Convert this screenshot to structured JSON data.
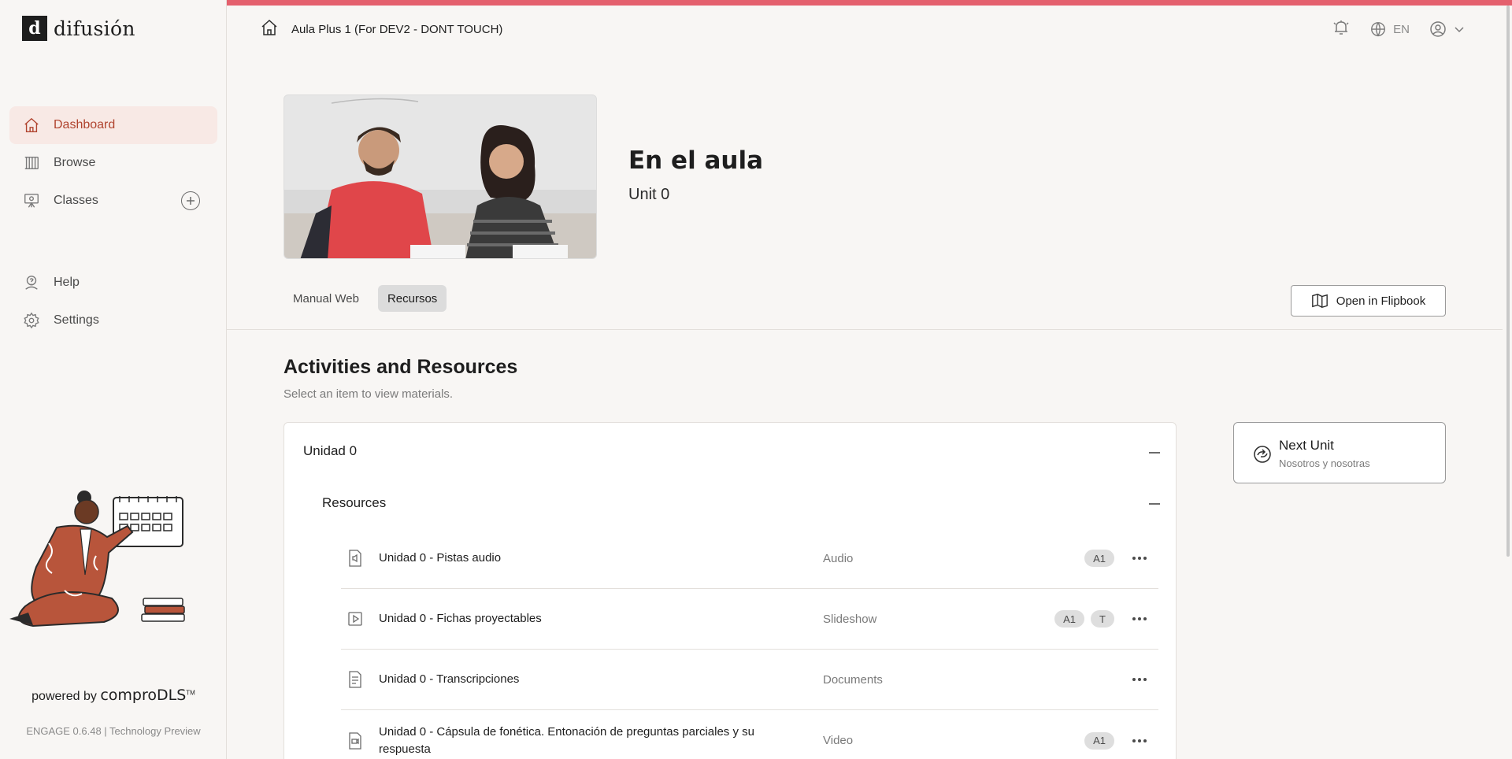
{
  "brand": {
    "logo_letter": "d",
    "name": "difusión"
  },
  "sidebar": {
    "items": [
      {
        "label": "Dashboard",
        "icon": "home-icon",
        "active": true
      },
      {
        "label": "Browse",
        "icon": "library-icon"
      },
      {
        "label": "Classes",
        "icon": "classroom-icon"
      },
      {
        "label": "Help",
        "icon": "help-icon"
      },
      {
        "label": "Settings",
        "icon": "gear-icon"
      }
    ],
    "powered_by": "powered by",
    "powered_brand": "comproDLS",
    "powered_tm": "TM",
    "version": "ENGAGE 0.6.48 | Technology Preview"
  },
  "header": {
    "breadcrumb": "Aula Plus 1 (For DEV2 - DONT TOUCH)",
    "language": "EN"
  },
  "hero": {
    "title": "En el aula",
    "subtitle": "Unit 0"
  },
  "tabs": [
    {
      "label": "Manual Web",
      "active": false
    },
    {
      "label": "Recursos",
      "active": true
    }
  ],
  "flipbook_button": "Open in Flipbook",
  "section": {
    "title": "Activities and Resources",
    "subtitle": "Select an item to view materials."
  },
  "unit": {
    "title": "Unidad 0",
    "group_title": "Resources",
    "resources": [
      {
        "title": "Unidad 0 - Pistas audio",
        "type": "Audio",
        "icon": "audio-file-icon",
        "badges": [
          "A1"
        ]
      },
      {
        "title": "Unidad 0 - Fichas proyectables",
        "type": "Slideshow",
        "icon": "slideshow-icon",
        "badges": [
          "A1",
          "T"
        ]
      },
      {
        "title": "Unidad 0 - Transcripciones",
        "type": "Documents",
        "icon": "document-icon",
        "badges": []
      },
      {
        "title": "Unidad 0 - Cápsula de fonética. Entonación de preguntas parciales y su respuesta",
        "type": "Video",
        "icon": "video-file-icon",
        "badges": [
          "A1"
        ]
      }
    ]
  },
  "next_unit": {
    "label": "Next Unit",
    "subtitle": "Nosotros y nosotras"
  },
  "colors": {
    "accent": "#b0432e",
    "active_bg": "#f8e9e5",
    "top_stripe": "#e4606d"
  }
}
